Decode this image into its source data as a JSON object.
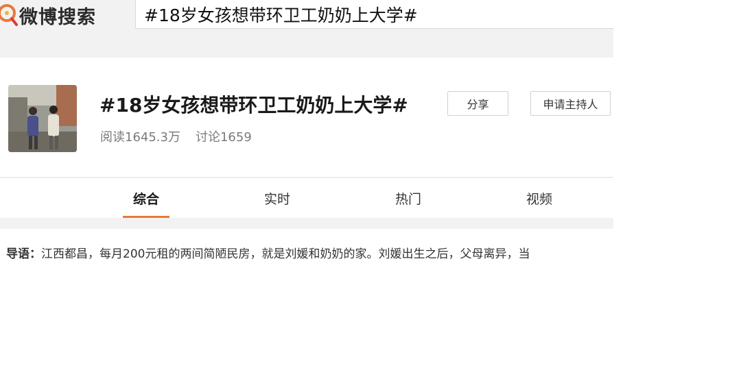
{
  "header": {
    "logo_text": "微博搜索",
    "logo_icon": "weibo-search-icon",
    "search_query": "#18岁女孩想带环卫工奶奶上大学#"
  },
  "topic": {
    "title": "#18岁女孩想带环卫工奶奶上大学#",
    "reads": "阅读1645.3万",
    "discussions": "讨论1659",
    "share_label": "分享",
    "apply_host_label": "申请主持人"
  },
  "tabs": [
    {
      "label": "综合",
      "active": true
    },
    {
      "label": "实时",
      "active": false
    },
    {
      "label": "热门",
      "active": false
    },
    {
      "label": "视频",
      "active": false
    }
  ],
  "lead": {
    "label": "导语：",
    "text": "江西都昌，每月200元租的两间简陋民房，就是刘媛和奶奶的家。刘媛出生之后，父母离异，当"
  },
  "colors": {
    "accent": "#e8793b",
    "header_bg": "#f2f2f2"
  }
}
